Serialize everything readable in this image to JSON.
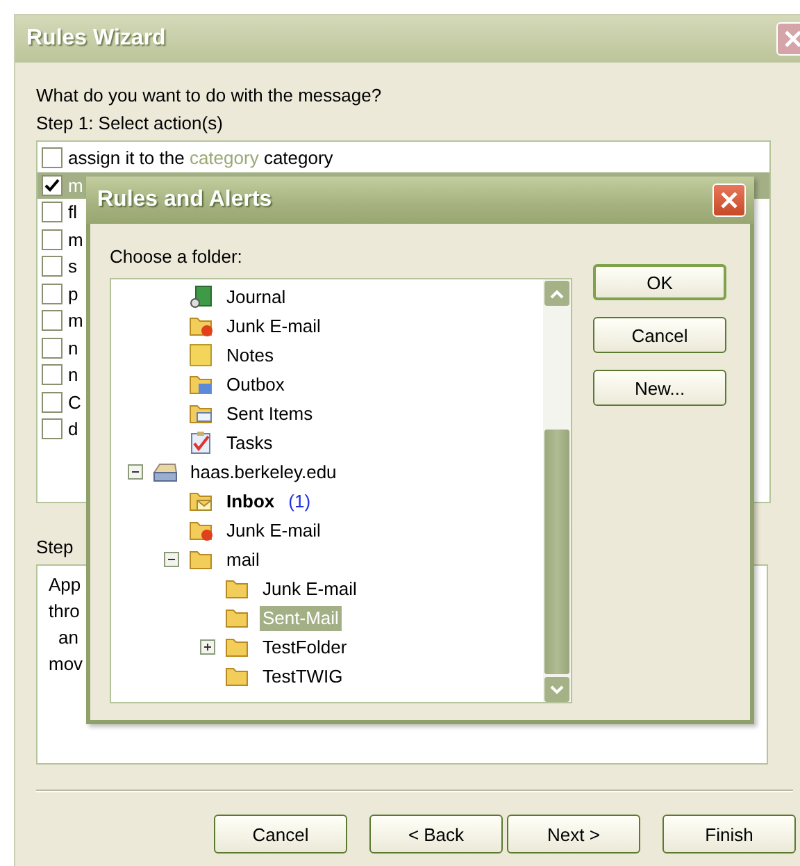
{
  "wizard": {
    "title": "Rules Wizard",
    "question": "What do you want to do with the message?",
    "step1_label": "Step 1: Select action(s)",
    "actions": [
      {
        "parts": [
          {
            "text": "assign it to the ",
            "kind": "plain"
          },
          {
            "text": "category",
            "kind": "link"
          },
          {
            "text": " category",
            "kind": "plain"
          }
        ],
        "checked": false,
        "selected": false
      },
      {
        "parts": [
          {
            "text": "m",
            "kind": "plain"
          }
        ],
        "checked": true,
        "selected": true
      },
      {
        "parts": [
          {
            "text": "fl",
            "kind": "plain"
          }
        ],
        "checked": false,
        "selected": false
      },
      {
        "parts": [
          {
            "text": "m",
            "kind": "plain"
          }
        ],
        "checked": false,
        "selected": false
      },
      {
        "parts": [
          {
            "text": "s",
            "kind": "plain"
          }
        ],
        "checked": false,
        "selected": false
      },
      {
        "parts": [
          {
            "text": "p",
            "kind": "plain"
          }
        ],
        "checked": false,
        "selected": false
      },
      {
        "parts": [
          {
            "text": "m",
            "kind": "plain"
          }
        ],
        "checked": false,
        "selected": false
      },
      {
        "parts": [
          {
            "text": "n",
            "kind": "plain"
          }
        ],
        "checked": false,
        "selected": false
      },
      {
        "parts": [
          {
            "text": "n",
            "kind": "plain"
          }
        ],
        "checked": false,
        "selected": false
      },
      {
        "parts": [
          {
            "text": "C",
            "kind": "plain"
          }
        ],
        "checked": false,
        "selected": false
      },
      {
        "parts": [
          {
            "text": "d",
            "kind": "plain"
          }
        ],
        "checked": false,
        "selected": false
      }
    ],
    "step2_label": "Step",
    "description_lines": [
      {
        "text": "App",
        "indented": false
      },
      {
        "text": "thro",
        "indented": false
      },
      {
        "text": "an",
        "indented": true
      },
      {
        "text": "mov",
        "indented": false
      }
    ],
    "buttons": [
      "Cancel",
      "< Back",
      "Next >",
      "Finish"
    ]
  },
  "dialog": {
    "title": "Rules and Alerts",
    "prompt": "Choose a folder:",
    "tree": {
      "scrolled_items": [
        {
          "label": "Journal",
          "kind": "journal",
          "selected": false
        },
        {
          "label": "Junk E-mail",
          "kind": "junk",
          "selected": false
        },
        {
          "label": "Notes",
          "kind": "notes",
          "selected": false
        },
        {
          "label": "Outbox",
          "kind": "outbox",
          "selected": false
        },
        {
          "label": "Sent Items",
          "kind": "sent",
          "selected": false
        },
        {
          "label": "Tasks",
          "kind": "tasks",
          "selected": false
        }
      ],
      "roots": [
        {
          "label": "haas.berkeley.edu",
          "kind": "server",
          "selected": false,
          "expanded": true,
          "children": [
            {
              "label": "Inbox",
              "kind": "inbox",
              "selected": false,
              "bold": true,
              "count": "(1)"
            },
            {
              "label": "Junk E-mail",
              "kind": "junk",
              "selected": false
            },
            {
              "label": "mail",
              "kind": "folder",
              "selected": false,
              "expanded": true,
              "children": [
                {
                  "label": "Junk E-mail",
                  "kind": "folder",
                  "selected": false
                },
                {
                  "label": "Sent-Mail",
                  "kind": "folder",
                  "selected": true
                },
                {
                  "label": "TestFolder",
                  "kind": "folder",
                  "selected": false,
                  "expanded": false
                },
                {
                  "label": "TestTWIG",
                  "kind": "folder",
                  "selected": false
                }
              ]
            }
          ]
        }
      ]
    },
    "buttons": [
      "OK",
      "Cancel",
      "New..."
    ]
  }
}
